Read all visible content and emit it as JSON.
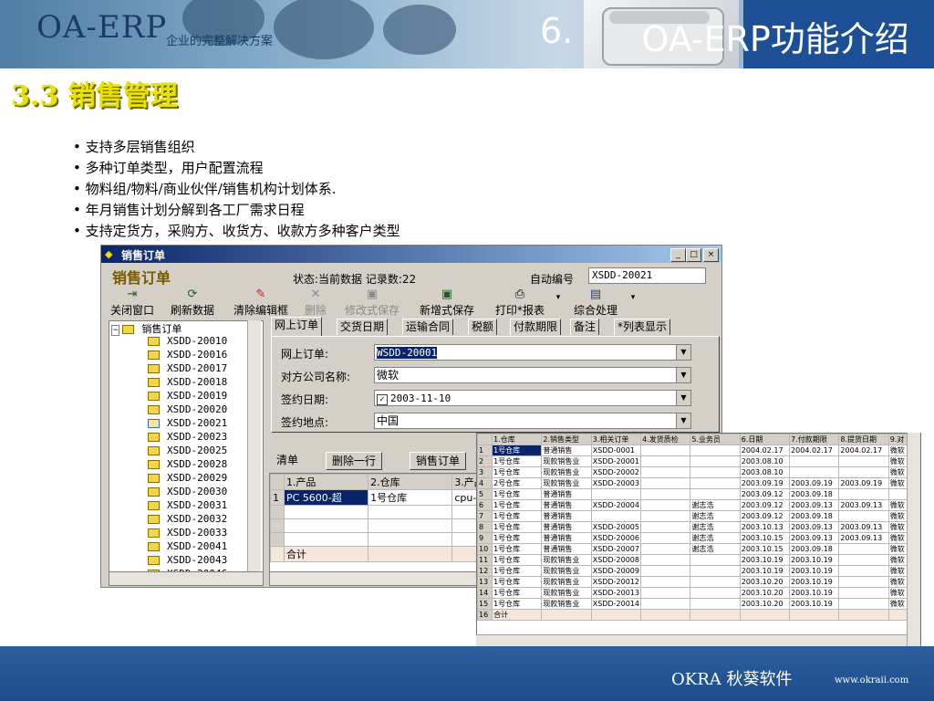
{
  "header": {
    "logo": "OA-ERP",
    "tagline": "企业的完整解决方案",
    "section_number": "6.",
    "title": "OA-ERP功能介绍"
  },
  "heading": "3.3 销售管理",
  "bullets": [
    "支持多层销售组织",
    "多种订单类型，用户配置流程",
    "物料组/物料/商业伙伴/销售机构计划体系.",
    "年月销售计划分解到各工厂需求日程",
    "支持定货方，采购方、收货方、收款方多种客户类型"
  ],
  "window": {
    "title": "销售订单",
    "form_name": "销售订单",
    "status": "状态:当前数据 记录数:22",
    "auto_number_label": "自动编号",
    "auto_number_value": "XSDD-20021",
    "toolbar": [
      {
        "label": "关闭窗口",
        "icon": "close-window-icon",
        "enabled": true
      },
      {
        "label": "刷新数据",
        "icon": "refresh-icon",
        "enabled": true
      },
      {
        "label": "清除编辑框",
        "icon": "eraser-icon",
        "enabled": true
      },
      {
        "label": "删除",
        "icon": "delete-x-icon",
        "enabled": false
      },
      {
        "label": "修改式保存",
        "icon": "save-icon",
        "enabled": false
      },
      {
        "label": "新增式保存",
        "icon": "save-new-icon",
        "enabled": true
      },
      {
        "label": "打印*报表",
        "icon": "printer-icon",
        "enabled": true
      },
      {
        "label": "综合处理",
        "icon": "process-icon",
        "enabled": true
      }
    ],
    "tree": {
      "root": "销售订单",
      "items": [
        "XSDD-20010",
        "XSDD-20016",
        "XSDD-20017",
        "XSDD-20018",
        "XSDD-20019",
        "XSDD-20020",
        "XSDD-20021",
        "XSDD-20023",
        "XSDD-20025",
        "XSDD-20028",
        "XSDD-20029",
        "XSDD-20030",
        "XSDD-20031",
        "XSDD-20032",
        "XSDD-20033",
        "XSDD-20041",
        "XSDD-20043",
        "XSDD-20046"
      ],
      "open_item": "XSDD-20021"
    },
    "tabs": [
      "网上订单",
      "交货日期",
      "运输合同",
      "税额",
      "付款期限",
      "备注",
      "*列表显示"
    ],
    "form": {
      "order_label": "网上订单:",
      "order_value": "WSDD-20001",
      "company_label": "对方公司名称:",
      "company_value": "微软",
      "date_label": "签约日期:",
      "date_value": "2003-11-10",
      "place_label": "签约地点:",
      "place_value": "中国"
    },
    "detail_buttons": [
      "清单",
      "删除一行",
      "销售订单"
    ],
    "detail_grid": {
      "columns": [
        "1.产品",
        "2.仓库",
        "3.产品规格"
      ],
      "rows": [
        [
          "PC 5600-超",
          "1号仓库",
          "cpu-5600"
        ]
      ],
      "total_label": "合计"
    }
  },
  "grid2": {
    "columns": [
      "1.仓库",
      "2.销售类型",
      "3.相关订单",
      "4.发货质检",
      "5.业务员",
      "6.日期",
      "7.付款期限",
      "8.提货日期",
      "9.对"
    ],
    "rows": [
      [
        "1号仓库",
        "普通销售",
        "XSDD-0001",
        "",
        "",
        "2004.02.17",
        "2004.02.17",
        "2004.02.17",
        "微软"
      ],
      [
        "1号仓库",
        "现款销售业",
        "XSDD-20001",
        "",
        "",
        "2003.08.10",
        "",
        "",
        "微软"
      ],
      [
        "1号仓库",
        "现款销售业",
        "XSDD-20002",
        "",
        "",
        "2003.08.10",
        "",
        "",
        "微软"
      ],
      [
        "2号仓库",
        "现款销售业",
        "XSDD-20003",
        "",
        "",
        "2003.09.19",
        "2003.09.19",
        "2003.09.19",
        "微软"
      ],
      [
        "1号仓库",
        "普通销售",
        "",
        "",
        "",
        "2003.09.12",
        "2003.09.18",
        "",
        ""
      ],
      [
        "1号仓库",
        "普通销售",
        "XSDD-20004",
        "",
        "谢志浩",
        "2003.09.12",
        "2003.09.13",
        "2003.09.13",
        "微软"
      ],
      [
        "1号仓库",
        "普通销售",
        "",
        "",
        "谢志浩",
        "2003.09.12",
        "2003.09.18",
        "",
        "微软"
      ],
      [
        "1号仓库",
        "普通销售",
        "XSDD-20005",
        "",
        "谢志浩",
        "2003.10.13",
        "2003.09.13",
        "2003.09.13",
        "微软"
      ],
      [
        "1号仓库",
        "普通销售",
        "XSDD-20006",
        "",
        "谢志浩",
        "2003.10.15",
        "2003.09.13",
        "2003.09.13",
        "微软"
      ],
      [
        "1号仓库",
        "普通销售",
        "XSDD-20007",
        "",
        "谢志浩",
        "2003.10.15",
        "2003.09.18",
        "",
        "微软"
      ],
      [
        "1号仓库",
        "现款销售业",
        "XSDD-20008",
        "",
        "",
        "2003.10.19",
        "2003.10.19",
        "",
        "微软"
      ],
      [
        "1号仓库",
        "现款销售业",
        "XSDD-20009",
        "",
        "",
        "2003.10.19",
        "2003.10.19",
        "",
        "微软"
      ],
      [
        "1号仓库",
        "现款销售业",
        "XSDD-20012",
        "",
        "",
        "2003.10.20",
        "2003.10.19",
        "",
        "微软"
      ],
      [
        "1号仓库",
        "现款销售业",
        "XSDD-20013",
        "",
        "",
        "2003.10.20",
        "2003.10.19",
        "",
        "微软"
      ],
      [
        "1号仓库",
        "现款销售业",
        "XSDD-20014",
        "",
        "",
        "2003.10.20",
        "2003.10.19",
        "",
        "微软"
      ]
    ],
    "total_label": "合计"
  },
  "footer": {
    "brand": "OKRA 秋葵软件",
    "url": "www.okraii.com"
  },
  "colors": {
    "header_title_bg": "#1c4f95",
    "footer_bg": "#1d4c8a",
    "heading": "#e9e100",
    "window_titlebar": "#0a246a",
    "window_bg": "#d4d0c8"
  }
}
